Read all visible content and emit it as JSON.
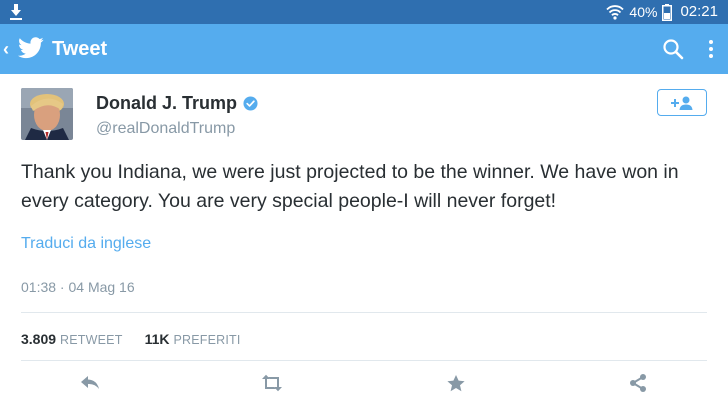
{
  "status_bar": {
    "battery": "40%",
    "time": "02:21"
  },
  "app_bar": {
    "title": "Tweet"
  },
  "tweet": {
    "display_name": "Donald J. Trump",
    "handle": "@realDonaldTrump",
    "text": "Thank you Indiana, we were just projected to be the winner. We have won in every category. You are very special people-I will never forget!",
    "translate_label": "Traduci da inglese",
    "timestamp": "01:38 · 04 Mag 16",
    "retweet_count": "3.809",
    "retweet_label": "RETWEET",
    "favorite_count": "11K",
    "favorite_label": "PREFERITI"
  },
  "icons": {
    "download": "download-icon",
    "wifi": "wifi-icon",
    "battery": "battery-icon",
    "back": "chevron-left-icon",
    "logo": "twitter-bird-icon",
    "search": "search-icon",
    "overflow": "more-vertical-icon",
    "verified": "verified-badge-icon",
    "follow": "follow-user-icon",
    "reply": "reply-icon",
    "retweet": "retweet-icon",
    "favorite": "star-icon",
    "share": "share-icon"
  },
  "colors": {
    "status_bar": "#2f6fb0",
    "app_bar": "#55acee",
    "accent": "#55acee",
    "text_primary": "#292f33",
    "text_secondary": "#8899a6",
    "action_icon": "#8899a6"
  }
}
